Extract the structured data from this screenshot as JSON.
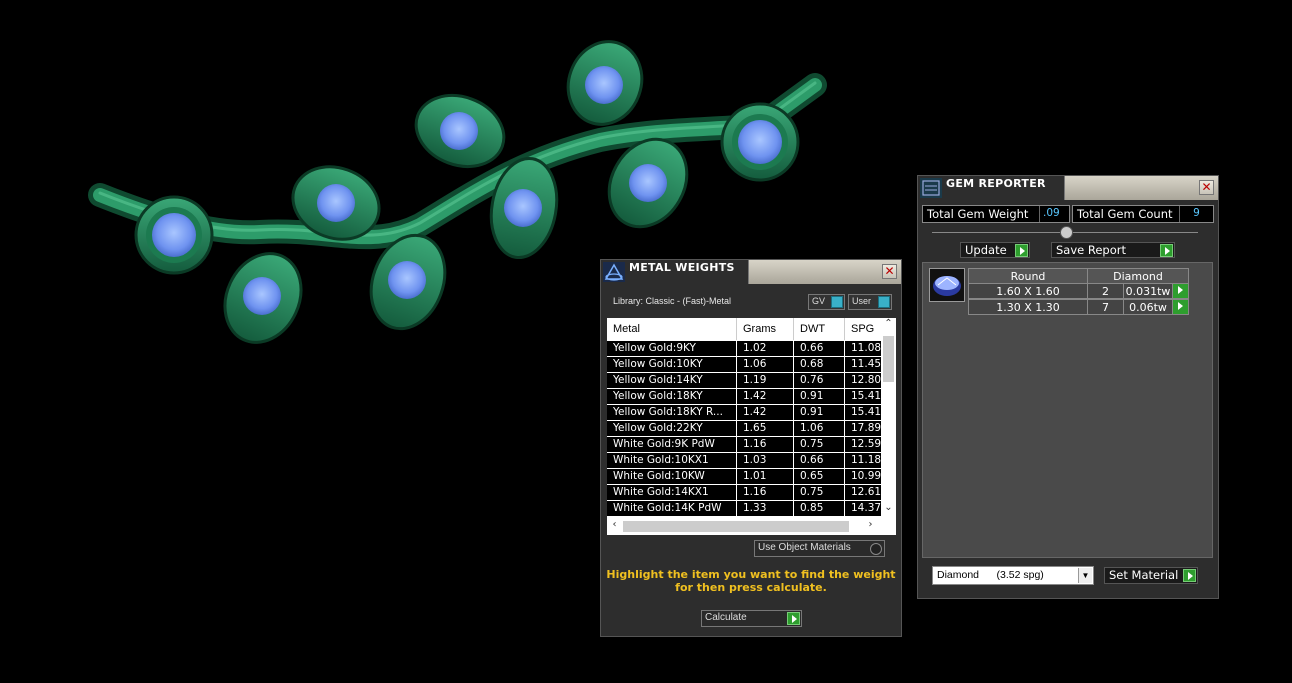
{
  "metal_weights": {
    "title": "METAL WEIGHTS",
    "library_label": "Library: Classic - (Fast)-Metal",
    "toggle_gv": "GV",
    "toggle_user": "User",
    "columns": [
      "Metal",
      "Grams",
      "DWT",
      "SPG"
    ],
    "rows": [
      [
        "Yellow Gold:9KY",
        "1.02",
        "0.66",
        "11.08"
      ],
      [
        "Yellow Gold:10KY",
        "1.06",
        "0.68",
        "11.45"
      ],
      [
        "Yellow Gold:14KY",
        "1.19",
        "0.76",
        "12.80"
      ],
      [
        "Yellow Gold:18KY",
        "1.42",
        "0.91",
        "15.41"
      ],
      [
        "Yellow Gold:18KY R...",
        "1.42",
        "0.91",
        "15.41"
      ],
      [
        "Yellow Gold:22KY",
        "1.65",
        "1.06",
        "17.89"
      ],
      [
        "White Gold:9K PdW",
        "1.16",
        "0.75",
        "12.59"
      ],
      [
        "White Gold:10KX1",
        "1.03",
        "0.66",
        "11.18"
      ],
      [
        "White Gold:10KW",
        "1.01",
        "0.65",
        "10.99"
      ],
      [
        "White Gold:14KX1",
        "1.16",
        "0.75",
        "12.61"
      ],
      [
        "White Gold:14K PdW",
        "1.33",
        "0.85",
        "14.37"
      ]
    ],
    "use_object_materials": "Use Object Materials",
    "hint_line1": "Highlight the item you want to find the weight",
    "hint_line2": "for then press calculate.",
    "calculate_label": "Calculate"
  },
  "gem_reporter": {
    "title": "GEM REPORTER",
    "total_gem_weight_label": "Total Gem Weight",
    "total_gem_weight_value": ".09",
    "total_gem_count_label": "Total Gem Count",
    "total_gem_count_value": "9",
    "update_label": "Update",
    "save_report_label": "Save Report",
    "table_headers": [
      "Round",
      "Diamond"
    ],
    "rows": [
      {
        "size": "1.60 X 1.60",
        "count": "2",
        "weight": "0.031tw"
      },
      {
        "size": "1.30 X 1.30",
        "count": "7",
        "weight": "0.06tw"
      }
    ],
    "material_select": "Diamond      (3.52 spg)",
    "set_material_label": "Set Material"
  },
  "colors": {
    "metal_green": "#1f8a5c",
    "gem_blue": "#7aa8ff",
    "hint_yellow": "#f0c020",
    "go_green": "#2e9e2e"
  }
}
